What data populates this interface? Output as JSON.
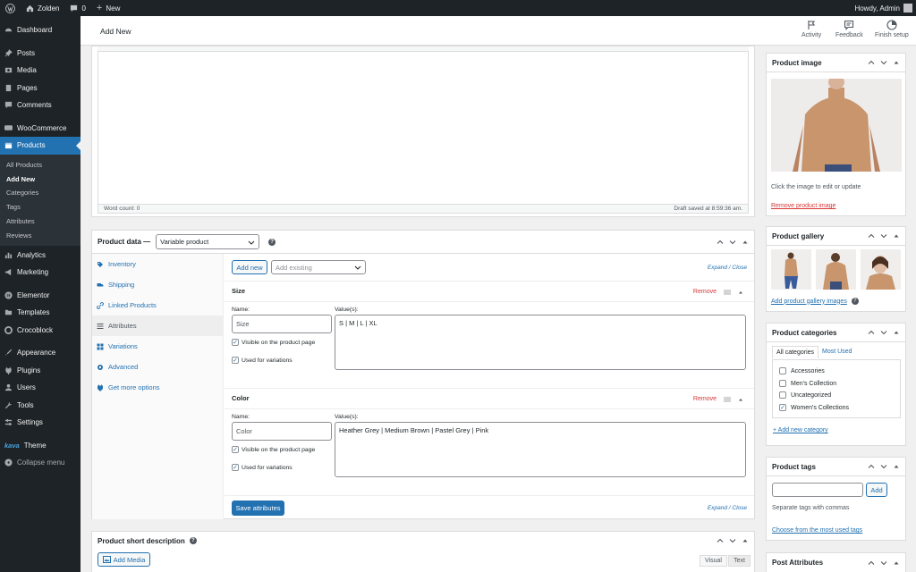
{
  "admin_bar": {
    "site_name": "Zolden",
    "comments_count": "0",
    "new_label": "New",
    "howdy": "Howdy, Admin"
  },
  "sidebar": {
    "items_top": [
      {
        "label": "Dashboard",
        "icon": "dashboard-icon"
      },
      {
        "label": "Posts",
        "icon": "pin-icon"
      },
      {
        "label": "Media",
        "icon": "media-icon"
      },
      {
        "label": "Pages",
        "icon": "page-icon"
      },
      {
        "label": "Comments",
        "icon": "comment-icon"
      },
      {
        "label": "WooCommerce",
        "icon": "woocommerce-icon"
      },
      {
        "label": "Products",
        "icon": "products-icon"
      }
    ],
    "submenu": [
      "All Products",
      "Add New",
      "Categories",
      "Tags",
      "Attributes",
      "Reviews"
    ],
    "items_bottom": [
      {
        "label": "Analytics",
        "icon": "analytics-icon"
      },
      {
        "label": "Marketing",
        "icon": "megaphone-icon"
      },
      {
        "label": "Elementor",
        "icon": "elementor-icon"
      },
      {
        "label": "Templates",
        "icon": "folder-icon"
      },
      {
        "label": "Crocoblock",
        "icon": "crocoblock-icon"
      },
      {
        "label": "Appearance",
        "icon": "brush-icon"
      },
      {
        "label": "Plugins",
        "icon": "plug-icon"
      },
      {
        "label": "Users",
        "icon": "users-icon"
      },
      {
        "label": "Tools",
        "icon": "wrench-icon"
      },
      {
        "label": "Settings",
        "icon": "settings-icon"
      },
      {
        "label": "Theme",
        "icon": "kava-logo-icon"
      },
      {
        "label": "Collapse menu",
        "icon": "collapse-icon"
      }
    ],
    "kava_logo": "kava"
  },
  "header": {
    "title": "Add New",
    "activity": "Activity",
    "feedback": "Feedback",
    "finish_setup": "Finish setup"
  },
  "editor": {
    "word_count": "Word count: 0",
    "draft_saved": "Draft saved at 8:59:36 am."
  },
  "product_data": {
    "title": "Product data —",
    "type_value": "Variable product",
    "help": "?",
    "tabs": [
      "Inventory",
      "Shipping",
      "Linked Products",
      "Attributes",
      "Variations",
      "Advanced",
      "Get more options"
    ],
    "add_new": "Add new",
    "add_existing_placeholder": "Add existing",
    "expand_close": "Expand / Close",
    "attributes": [
      {
        "heading": "Size",
        "remove": "Remove",
        "name_label": "Name:",
        "name_value": "Size",
        "values_label": "Value(s):",
        "values": "S | M | L | XL",
        "visible_label": "Visible on the product page",
        "variations_label": "Used for variations"
      },
      {
        "heading": "Color",
        "remove": "Remove",
        "name_label": "Name:",
        "name_value": "Color",
        "values_label": "Value(s):",
        "values": "Heather Grey | Medium Brown | Pastel Grey | Pink",
        "visible_label": "Visible on the product page",
        "variations_label": "Used for variations"
      }
    ],
    "save_attributes": "Save attributes"
  },
  "short_description": {
    "title": "Product short description",
    "add_media": "Add Media",
    "visual_tab": "Visual",
    "text_tab": "Text"
  },
  "product_image": {
    "title": "Product image",
    "hint": "Click the image to edit or update",
    "remove": "Remove product image"
  },
  "product_gallery": {
    "title": "Product gallery",
    "add_link": "Add product gallery images",
    "help": "?"
  },
  "product_categories": {
    "title": "Product categories",
    "tab_all": "All categories",
    "tab_most_used": "Most Used",
    "items": [
      {
        "label": "Accessories",
        "checked": false
      },
      {
        "label": "Men's Collection",
        "checked": false
      },
      {
        "label": "Uncategorized",
        "checked": false
      },
      {
        "label": "Women's Collections",
        "checked": true
      }
    ],
    "add_new": "+ Add new category"
  },
  "product_tags": {
    "title": "Product tags",
    "add_button": "Add",
    "hint": "Separate tags with commas",
    "choose_link": "Choose from the most used tags"
  },
  "post_attributes": {
    "title": "Post Attributes"
  },
  "colors": {
    "adminbar": "#1d2327",
    "accent": "#2271b1",
    "remove": "#d63638",
    "sweater": "#c8956d"
  }
}
